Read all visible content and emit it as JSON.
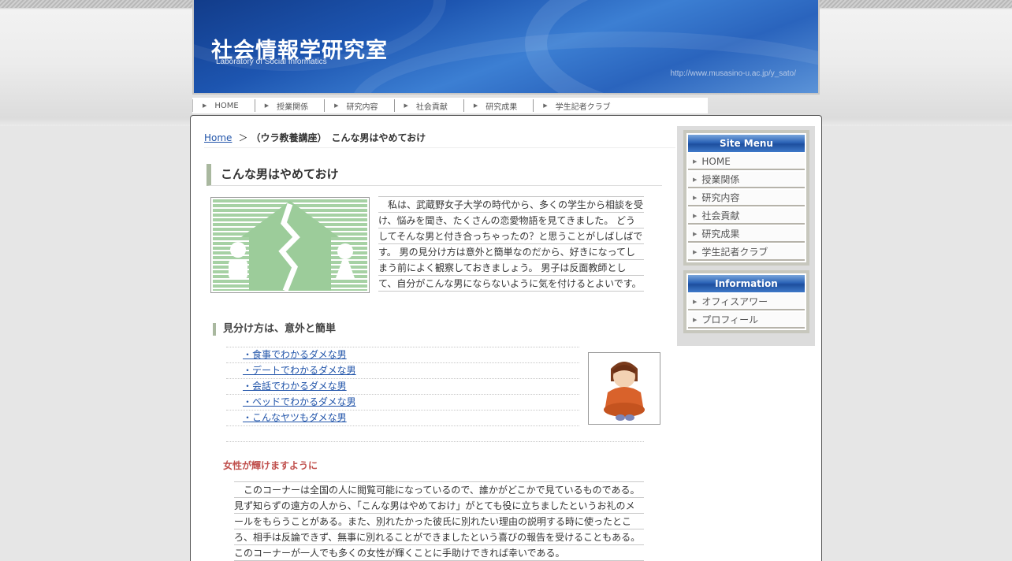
{
  "header": {
    "title": "社会情報学研究室",
    "subtitle": "Laboratory of Social Informatics",
    "url": "http://www.musasino-u.ac.jp/y_sato/"
  },
  "topnav": [
    "HOME",
    "授業関係",
    "研究内容",
    "社会貢献",
    "研究成果",
    "学生記者クラブ"
  ],
  "breadcrumb": {
    "home": "Home",
    "separator": "＞",
    "current": "（ウラ教養講座）　こんな男はやめておけ"
  },
  "page_title": "こんな男はやめておけ",
  "intro": "　私は、武蔵野女子大学の時代から、多くの学生から相談を受け、悩みを聞き、たくさんの恋愛物語を見てきました。 どうしてそんな男と付き合っちゃったの？と思うことがしばしばです。 男の見分け方は意外と簡単なのだから、好きになってしまう前によく観察しておきましょう。 男子は反面教師として、自分がこんな男にならないように気を付けるとよいです。",
  "section": {
    "heading": "見分け方は、意外と簡単",
    "links": [
      "・食事でわかるダメな男",
      "・デートでわかるダメな男",
      "・会話でわかるダメな男",
      "・ベッドでわかるダメな男",
      "・こんなヤツもダメな男"
    ]
  },
  "closing": {
    "heading": "女性が輝けますように",
    "text": "このコーナーは全国の人に閲覧可能になっているので、誰かがどこかで見ているものである。見ず知らずの遠方の人から、「こんな男はやめておけ」がとても役に立ちましたというお礼のメールをもらうことがある。また、別れたかった彼氏に別れたい理由の説明する時に使ったところ、相手は反論できず、無事に別れることができましたという喜びの報告を受けることもある。このコーナーが一人でも多くの女性が輝くことに手助けできれば幸いである。"
  },
  "sidebar": {
    "site_menu": {
      "title": "Site Menu",
      "items": [
        "HOME",
        "授業関係",
        "研究内容",
        "社会貢献",
        "研究成果",
        "学生記者クラブ"
      ]
    },
    "information": {
      "title": "Information",
      "items": [
        "オフィスアワー",
        "プロフィール"
      ]
    }
  },
  "colors": {
    "accent_green": "#a9b89f",
    "header_blue": "#1d55b0",
    "link_blue": "#2255aa",
    "subhead_red": "#c0504d",
    "illustration_green": "#9ccc9a",
    "illustration_orange": "#d9622b"
  }
}
